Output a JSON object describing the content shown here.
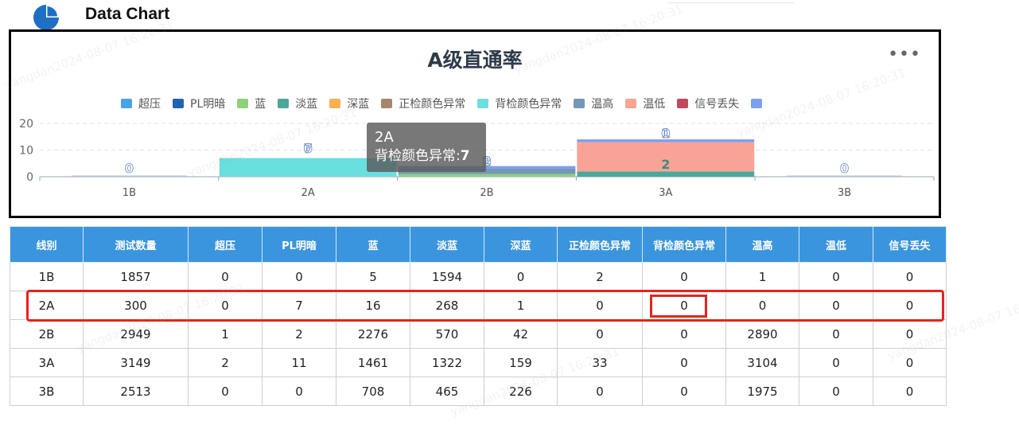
{
  "header": {
    "title": "Data Chart",
    "icon": "pie-chart-icon"
  },
  "chart_data": {
    "type": "bar",
    "stacked": true,
    "title": "A级直通率",
    "categories": [
      "1B",
      "2A",
      "2B",
      "3A",
      "3B"
    ],
    "ylim": [
      0,
      20
    ],
    "yticks": [
      0,
      10,
      20
    ],
    "grid": true,
    "legend_position": "top-center",
    "series": [
      {
        "name": "超压",
        "color": "#4aa3e6",
        "values": [
          0,
          0,
          0,
          0,
          0
        ]
      },
      {
        "name": "PL明暗",
        "color": "#2262b2",
        "values": [
          0,
          0,
          0,
          0,
          0
        ]
      },
      {
        "name": "蓝",
        "color": "#8fd178",
        "values": [
          0,
          0,
          1,
          0,
          0
        ]
      },
      {
        "name": "淡蓝",
        "color": "#4aa89a",
        "values": [
          0,
          0,
          0,
          2,
          0
        ]
      },
      {
        "name": "深蓝",
        "color": "#f9b24e",
        "values": [
          0,
          0,
          0,
          0,
          0
        ]
      },
      {
        "name": "正检颜色异常",
        "color": "#a8856e",
        "values": [
          0,
          0,
          0,
          0,
          0
        ]
      },
      {
        "name": "背检颜色异常",
        "color": "#6adfe0",
        "values": [
          0,
          7,
          0,
          0,
          0
        ]
      },
      {
        "name": "温高",
        "color": "#7498b6",
        "values": [
          0,
          0,
          2,
          0,
          0
        ]
      },
      {
        "name": "温低",
        "color": "#f9a397",
        "values": [
          0,
          0,
          0,
          11,
          0
        ]
      },
      {
        "name": "信号丢失",
        "color": "#c2485e",
        "values": [
          0,
          0,
          0,
          0,
          0
        ]
      },
      {
        "name": "",
        "color": "#7c9ff0",
        "values": [
          0,
          0,
          1,
          1,
          0
        ]
      }
    ],
    "bar_labels": [
      {
        "category": "1B",
        "text": "0"
      },
      {
        "category": "2A",
        "text": "7"
      },
      {
        "category": "2A",
        "text": "0"
      },
      {
        "category": "2B",
        "text": "0"
      },
      {
        "category": "2B",
        "text": "2"
      },
      {
        "category": "3A",
        "text": "2"
      },
      {
        "category": "3A",
        "text": "0"
      },
      {
        "category": "3A",
        "text": "1"
      },
      {
        "category": "3B",
        "text": "0"
      }
    ]
  },
  "tooltip": {
    "title": "2A",
    "label": "背检颜色异常:",
    "value": "7"
  },
  "table": {
    "headers": [
      "线别",
      "测试数量",
      "超压",
      "PL明暗",
      "蓝",
      "淡蓝",
      "深蓝",
      "正检颜色异常",
      "背检颜色异常",
      "温高",
      "温低",
      "信号丢失"
    ],
    "rows": [
      [
        "1B",
        "1857",
        "0",
        "0",
        "5",
        "1594",
        "0",
        "2",
        "0",
        "1",
        "0",
        "0"
      ],
      [
        "2A",
        "300",
        "0",
        "7",
        "16",
        "268",
        "1",
        "0",
        "0",
        "0",
        "0",
        "0"
      ],
      [
        "2B",
        "2949",
        "1",
        "2",
        "2276",
        "570",
        "42",
        "0",
        "0",
        "2890",
        "0",
        "0"
      ],
      [
        "3A",
        "3149",
        "2",
        "11",
        "1461",
        "1322",
        "159",
        "33",
        "0",
        "3104",
        "0",
        "0"
      ],
      [
        "3B",
        "2513",
        "0",
        "0",
        "708",
        "465",
        "226",
        "0",
        "0",
        "1975",
        "0",
        "0"
      ]
    ]
  },
  "watermark": "yangdan2024-08-07 16:20:31"
}
